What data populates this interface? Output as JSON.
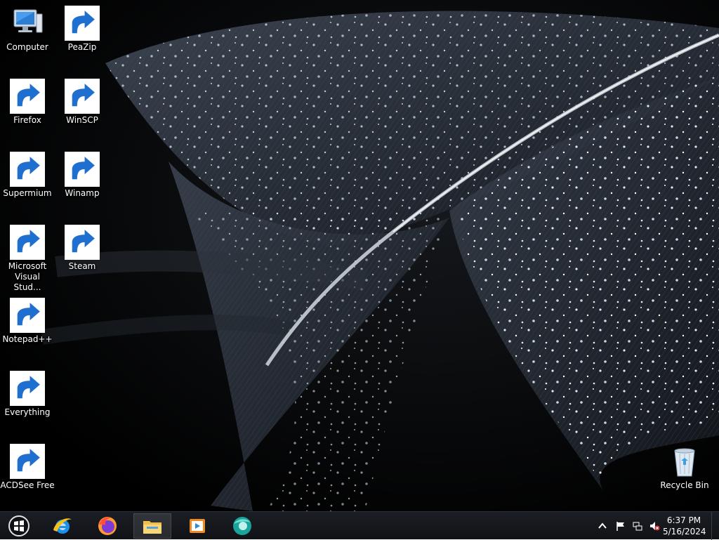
{
  "desktop": {
    "icons": [
      {
        "label": "Computer",
        "icon": "computer-icon"
      },
      {
        "label": "PeaZip",
        "icon": "peazip-icon"
      },
      {
        "label": "Firefox",
        "icon": "firefox-icon"
      },
      {
        "label": "WinSCP",
        "icon": "winscp-icon"
      },
      {
        "label": "Supermium",
        "icon": "supermium-icon"
      },
      {
        "label": "Winamp",
        "icon": "winamp-icon"
      },
      {
        "label": "Microsoft Visual Stud...",
        "icon": "visual-studio-icon"
      },
      {
        "label": "Steam",
        "icon": "steam-icon"
      },
      {
        "label": "Notepad++",
        "icon": "notepad-plus-plus-icon"
      },
      {
        "label": "Everything",
        "icon": "everything-icon"
      },
      {
        "label": "ACDSee Free",
        "icon": "acdsee-icon"
      },
      {
        "label": "Recycle Bin",
        "icon": "recycle-bin-icon"
      }
    ]
  },
  "taskbar": {
    "start_icon": "windows-start-icon",
    "pinned": [
      {
        "icon": "internet-explorer-icon"
      },
      {
        "icon": "firefox-icon"
      },
      {
        "icon": "file-explorer-icon",
        "active": true
      },
      {
        "icon": "media-player-icon"
      },
      {
        "icon": "supermium-icon"
      }
    ],
    "tray": {
      "icons": [
        "show-hidden-icons-icon",
        "action-center-flag-icon",
        "network-icon",
        "volume-muted-icon"
      ],
      "time": "6:37 PM",
      "date": "5/16/2024"
    }
  },
  "colors": {
    "taskbar_bg": "#14171c",
    "desktop_bg": "#000000",
    "label_text": "#ffffff"
  }
}
